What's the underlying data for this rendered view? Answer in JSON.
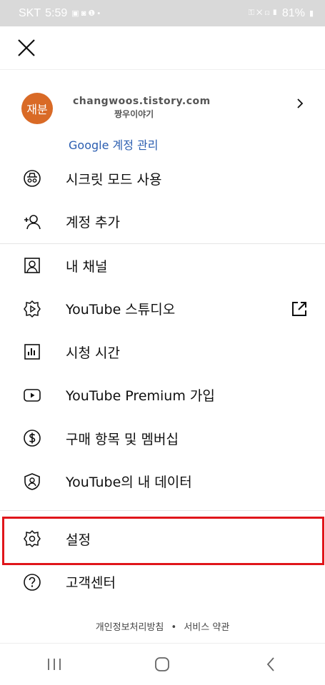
{
  "status_bar": {
    "carrier": "SKT",
    "time": "5:59",
    "battery": "81%"
  },
  "account": {
    "avatar_text": "재분",
    "url": "changwoos.tistory.com",
    "name": "짱우이야기",
    "manage_label": "Google 계정 관리"
  },
  "menu": {
    "incognito": "시크릿 모드 사용",
    "add_account": "계정 추가",
    "my_channel": "내 채널",
    "studio": "YouTube 스튜디오",
    "watch_time": "시청 시간",
    "premium": "YouTube Premium 가입",
    "purchases": "구매 항목 및 멤버십",
    "your_data": "YouTube의 내 데이터",
    "settings": "설정",
    "help": "고객센터"
  },
  "footer": {
    "privacy": "개인정보처리방침",
    "separator": "•",
    "terms": "서비스 약관"
  },
  "colors": {
    "highlight": "#e0161b",
    "link": "#2a5db0",
    "avatar": "#d96a26"
  }
}
